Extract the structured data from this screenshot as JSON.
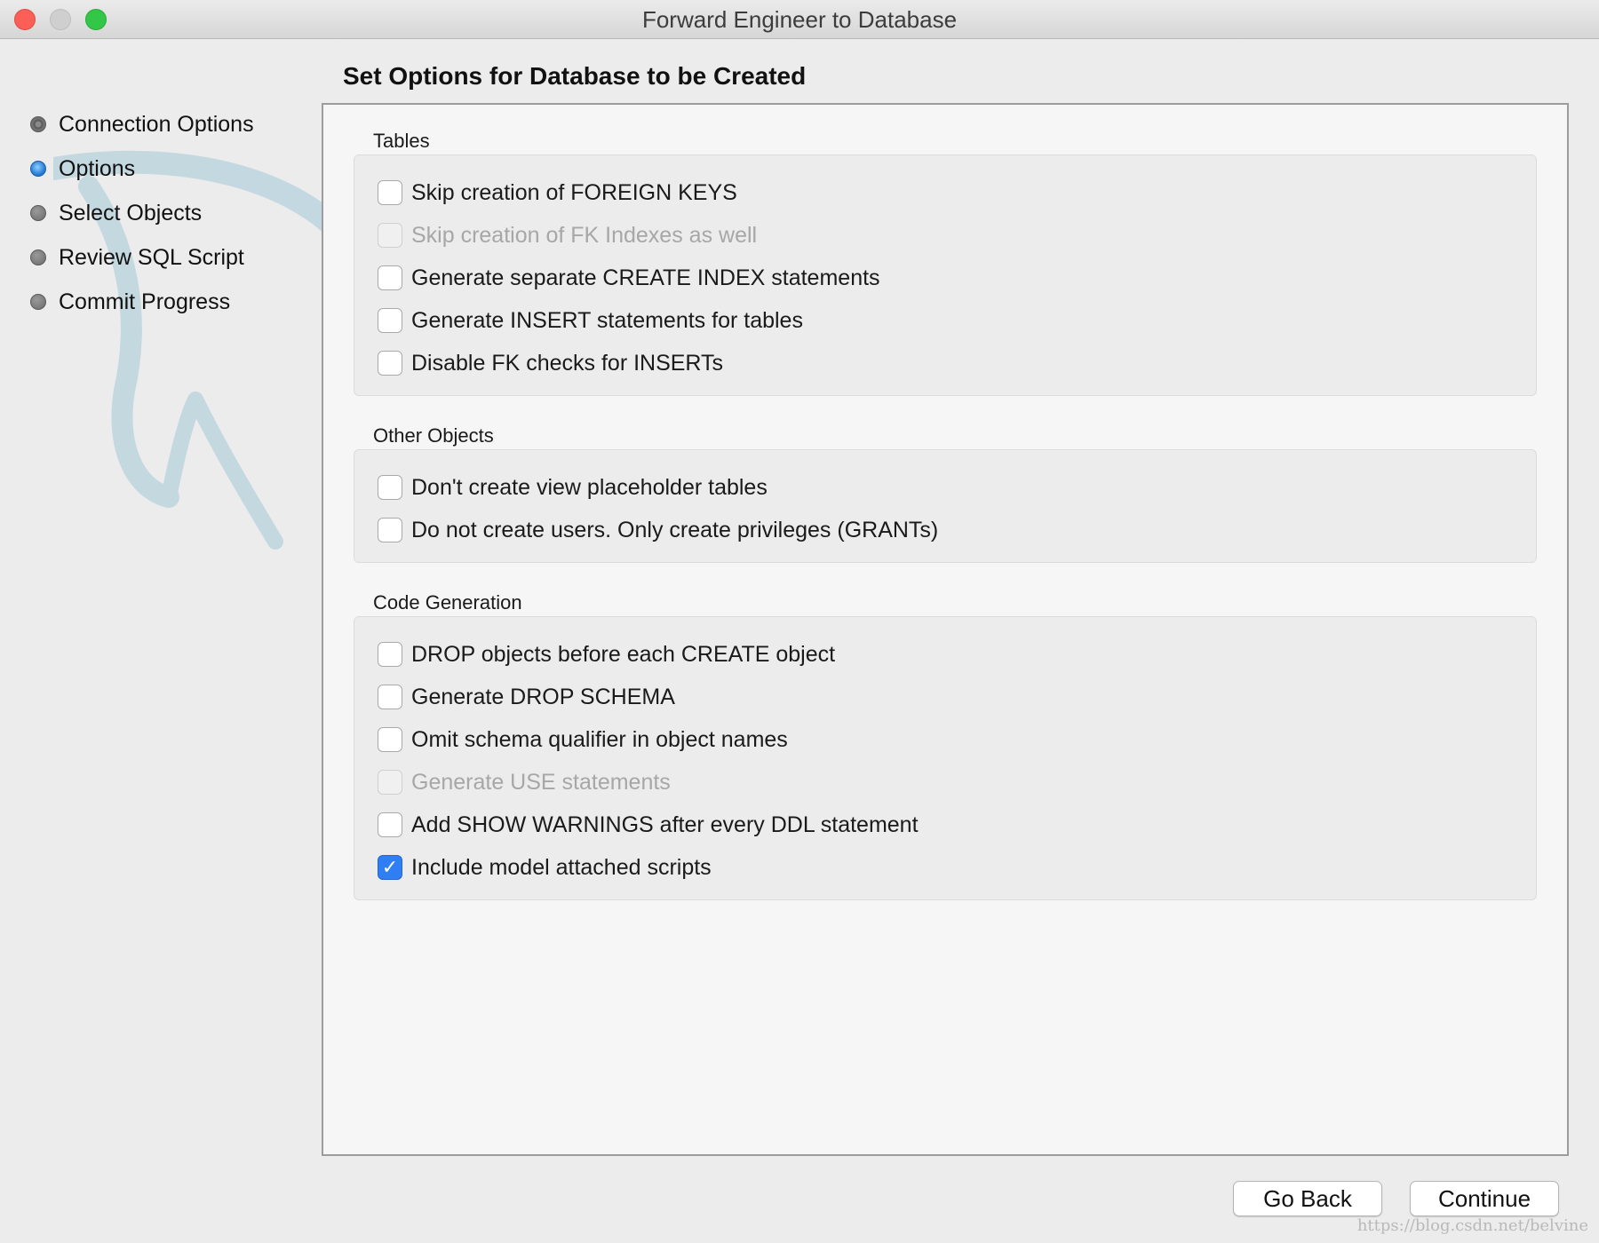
{
  "window": {
    "title": "Forward Engineer to Database"
  },
  "steps": [
    {
      "label": "Connection Options",
      "state": "done"
    },
    {
      "label": "Options",
      "state": "active"
    },
    {
      "label": "Select Objects",
      "state": "pending"
    },
    {
      "label": "Review SQL Script",
      "state": "pending"
    },
    {
      "label": "Commit Progress",
      "state": "pending"
    }
  ],
  "page": {
    "title": "Set Options for Database to be Created"
  },
  "groups": {
    "tables": {
      "title": "Tables",
      "options": [
        {
          "label": "Skip creation of FOREIGN KEYS",
          "checked": false,
          "enabled": true
        },
        {
          "label": "Skip creation of FK Indexes as well",
          "checked": false,
          "enabled": false
        },
        {
          "label": "Generate separate CREATE INDEX statements",
          "checked": false,
          "enabled": true
        },
        {
          "label": "Generate INSERT statements for tables",
          "checked": false,
          "enabled": true
        },
        {
          "label": "Disable FK checks for INSERTs",
          "checked": false,
          "enabled": true
        }
      ]
    },
    "other": {
      "title": "Other Objects",
      "options": [
        {
          "label": "Don't create view placeholder tables",
          "checked": false,
          "enabled": true
        },
        {
          "label": "Do not create users. Only create privileges (GRANTs)",
          "checked": false,
          "enabled": true
        }
      ]
    },
    "code": {
      "title": "Code Generation",
      "options": [
        {
          "label": "DROP objects before each CREATE object",
          "checked": false,
          "enabled": true
        },
        {
          "label": "Generate DROP SCHEMA",
          "checked": false,
          "enabled": true
        },
        {
          "label": "Omit schema qualifier in object names",
          "checked": false,
          "enabled": true
        },
        {
          "label": "Generate USE statements",
          "checked": false,
          "enabled": false
        },
        {
          "label": "Add SHOW WARNINGS after every DDL statement",
          "checked": false,
          "enabled": true
        },
        {
          "label": "Include model attached scripts",
          "checked": true,
          "enabled": true
        }
      ]
    }
  },
  "buttons": {
    "back": "Go Back",
    "continue": "Continue"
  },
  "credit": "https://blog.csdn.net/belvine",
  "colors": {
    "accent": "#2f7ef5",
    "active_step": "#2b7fd8",
    "panel": "#f6f6f6",
    "group_box": "#ececec"
  },
  "icons": {
    "watermark": "dolphin-watermark-icon",
    "checkmark": "checkmark-icon"
  }
}
